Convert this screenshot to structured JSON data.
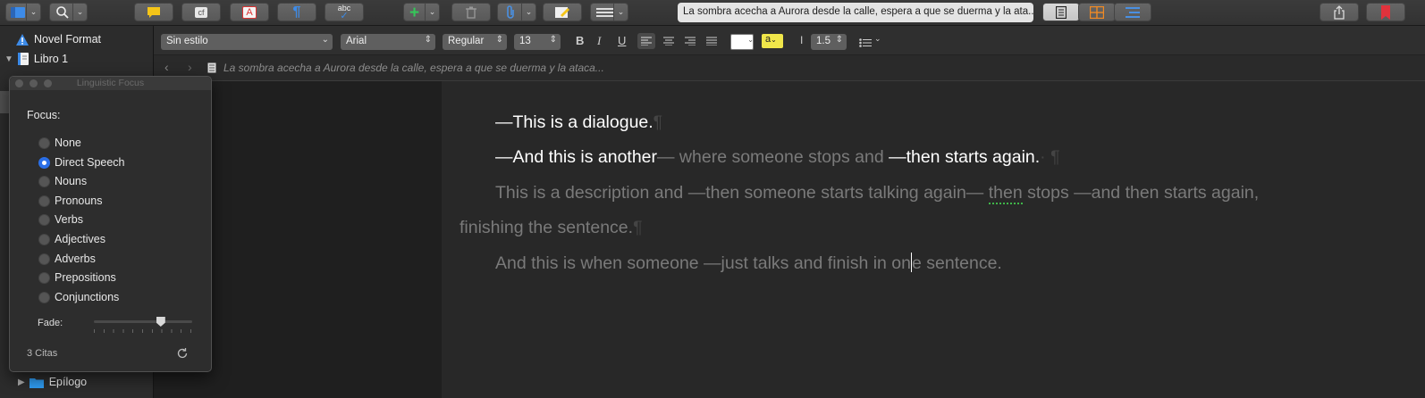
{
  "toolbar": {
    "doc_title": "La sombra acecha a Aurora desde la calle, espera a que se duerma y la ata...",
    "buttons": [
      "view-mode",
      "search",
      "comment",
      "snapshot",
      "annotation",
      "paragraph",
      "spelling",
      "add",
      "trash",
      "attach",
      "compose",
      "layout",
      "view-doc",
      "view-corkboard",
      "view-outline",
      "share",
      "bookmark"
    ],
    "snapshot_label": "cf",
    "annotation_label": "A",
    "paragraph_label": "¶",
    "spelling_label": "abc"
  },
  "binder": {
    "items": [
      {
        "label": "Novel Format",
        "icon": "warning-icon"
      },
      {
        "label": "Libro 1",
        "icon": "book-icon"
      },
      {
        "label": "Epílogo",
        "icon": "folder-icon"
      }
    ]
  },
  "formatbar": {
    "style": "Sin estilo",
    "font": "Arial",
    "weight": "Regular",
    "size": "13",
    "bold": "B",
    "italic": "I",
    "underline": "U",
    "highlight": "a",
    "line_spacing": "1.5"
  },
  "nav": {
    "title": "La sombra acecha a Aurora desde la calle, espera a que se duerma y la ataca..."
  },
  "editor": {
    "p1": {
      "dialogue": "—This is a dialogue.",
      "pilcrow": "¶"
    },
    "p2": {
      "d1": "—And this is another",
      "t1": "— where someone stops and ",
      "d2": "—then starts again.",
      "pilcrow": "· ¶"
    },
    "p3": {
      "t1": "This is a description and —then someone starts talking again— ",
      "squig": "then",
      "t2": " stops —and then starts again,",
      "t3": "finishing the sentence.",
      "pilcrow": "¶"
    },
    "p4": {
      "t1": "And this is when someone —just talks and finish in on",
      "t2": "e sentence."
    }
  },
  "panel": {
    "title": "Linguistic Focus",
    "focus_label": "Focus:",
    "options": [
      "None",
      "Direct Speech",
      "Nouns",
      "Pronouns",
      "Verbs",
      "Adjectives",
      "Adverbs",
      "Prepositions",
      "Conjunctions"
    ],
    "selected": "Direct Speech",
    "fade_label": "Fade:",
    "fade_value": 0.68,
    "count": "3 Citas"
  },
  "colors": {
    "accent": "#2a6fe8",
    "highlight_yellow": "#f0e64a",
    "comment_yellow": "#f5c518",
    "add_green": "#35c759",
    "bookmark_red": "#e0323c",
    "squiggle_green": "#3fb64a"
  }
}
